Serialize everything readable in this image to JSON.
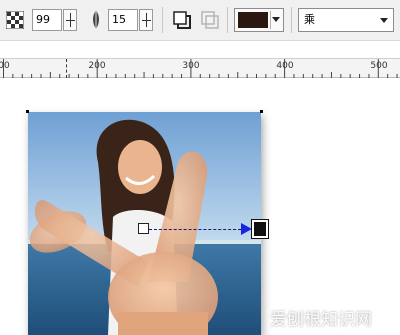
{
  "toolbar": {
    "opacity_icon": "transparency-checker-icon",
    "opacity_value": "99",
    "feather_icon": "feather-icon",
    "feather_value": "15",
    "shadow_direction_icon": "drop-shadow-outward-icon",
    "shadow_inner_icon": "drop-shadow-inner-icon",
    "shadow_color": "#2a1810",
    "blend_mode": "乘"
  },
  "ruler": {
    "labels": [
      "00",
      "200",
      "300",
      "400",
      "500"
    ]
  },
  "watermark": "爱刨根知识网"
}
